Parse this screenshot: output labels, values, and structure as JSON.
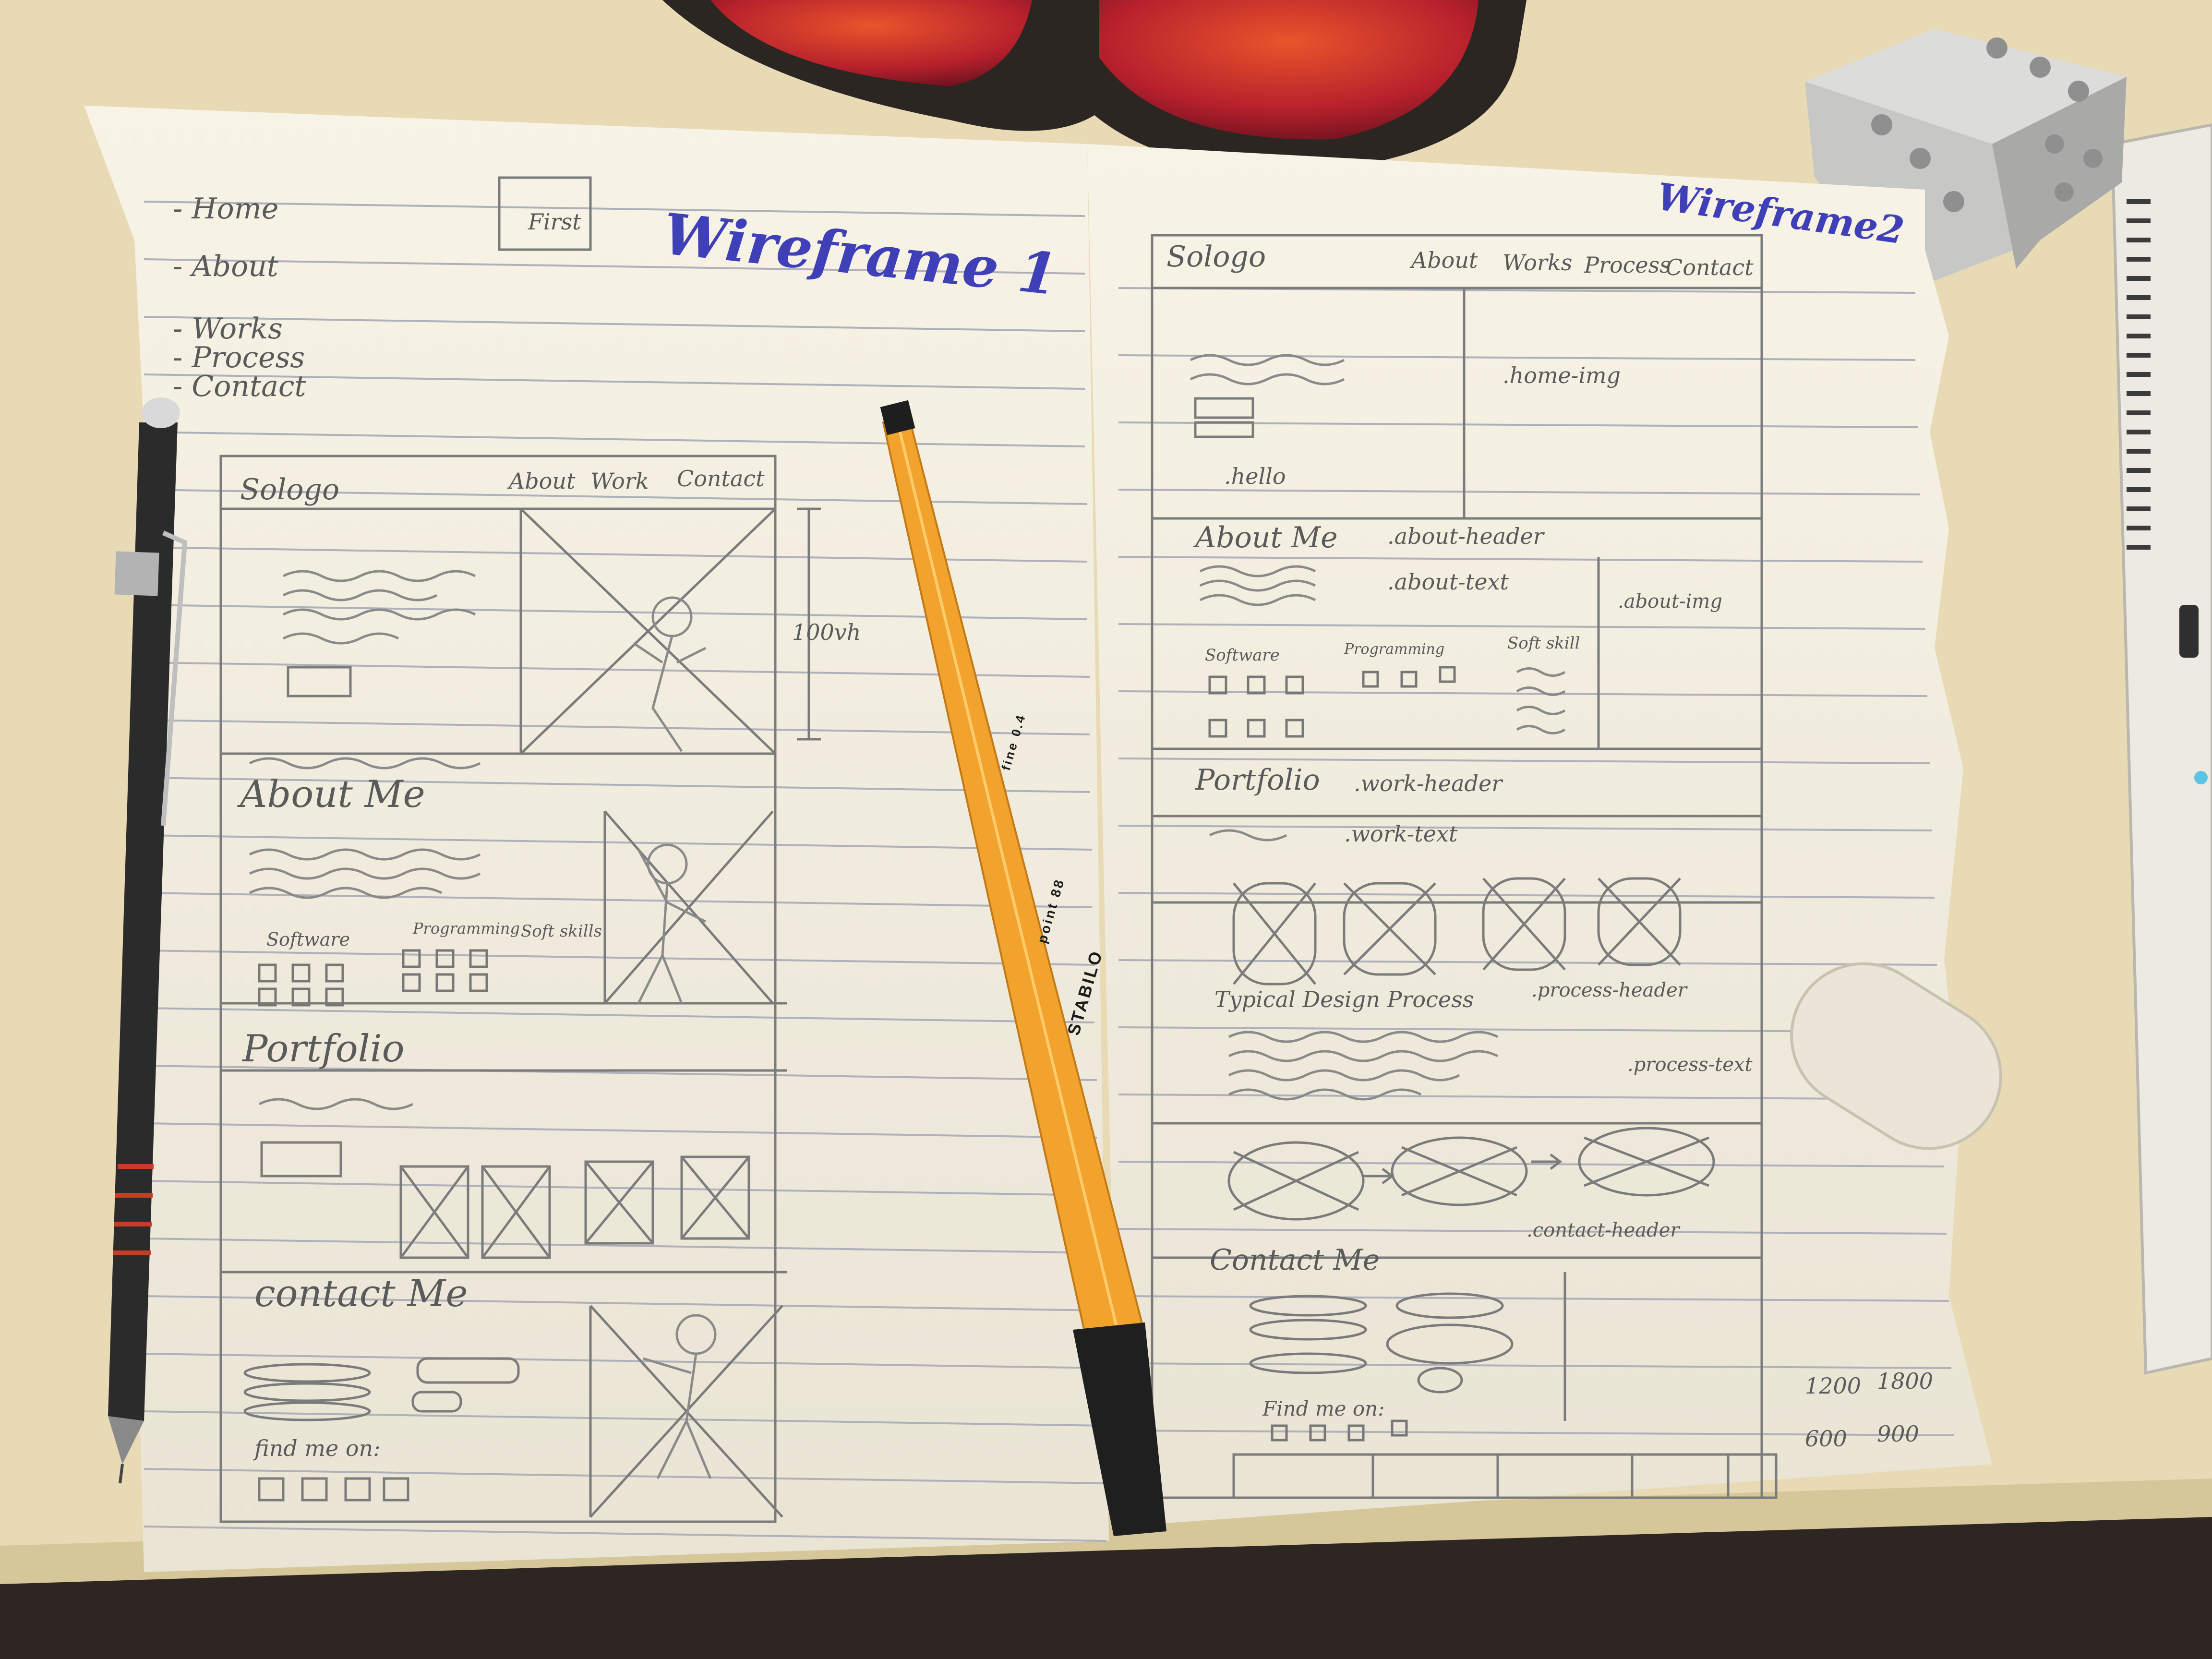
{
  "wireframe1": {
    "title": "Wireframe 1",
    "nav_list": [
      "- Home",
      "- About",
      "- Works",
      "- Process",
      "- Contact"
    ],
    "logo_box": "First",
    "header_logo": "Sologo",
    "header_nav": [
      "About",
      "Work",
      "Contact"
    ],
    "height_note": "100vh",
    "about_heading": "About Me",
    "skill_labels": [
      "Software",
      "Programming",
      "Soft skills"
    ],
    "portfolio_heading": "Portfolio",
    "contact_heading": "contact Me",
    "find_me": "find me on:"
  },
  "wireframe2": {
    "title": "Wireframe2",
    "header_logo": "Sologo",
    "header_nav": [
      "About",
      "Works",
      "Process",
      "Contact"
    ],
    "hero_labels": [
      ".home-img",
      ".hello"
    ],
    "about_heading": "About Me",
    "about_labels": [
      ".about-header",
      ".about-text",
      ".about-img"
    ],
    "skill_labels": [
      "Software",
      "Programming",
      "Soft skill"
    ],
    "portfolio_heading": "Portfolio",
    "portfolio_labels": [
      ".work-header",
      ".work-text"
    ],
    "process_heading": "Typical Design Process",
    "process_labels": [
      ".process-header",
      ".process-text"
    ],
    "contact_heading": "Contact Me",
    "contact_labels": [
      ".contact-header"
    ],
    "find_me": "Find me on:",
    "breakpoints": [
      "1200",
      "1800",
      "600",
      "900"
    ]
  },
  "pen_brand": "STABILO",
  "pen_model": "point 88",
  "pen_size": "fine 0.4"
}
